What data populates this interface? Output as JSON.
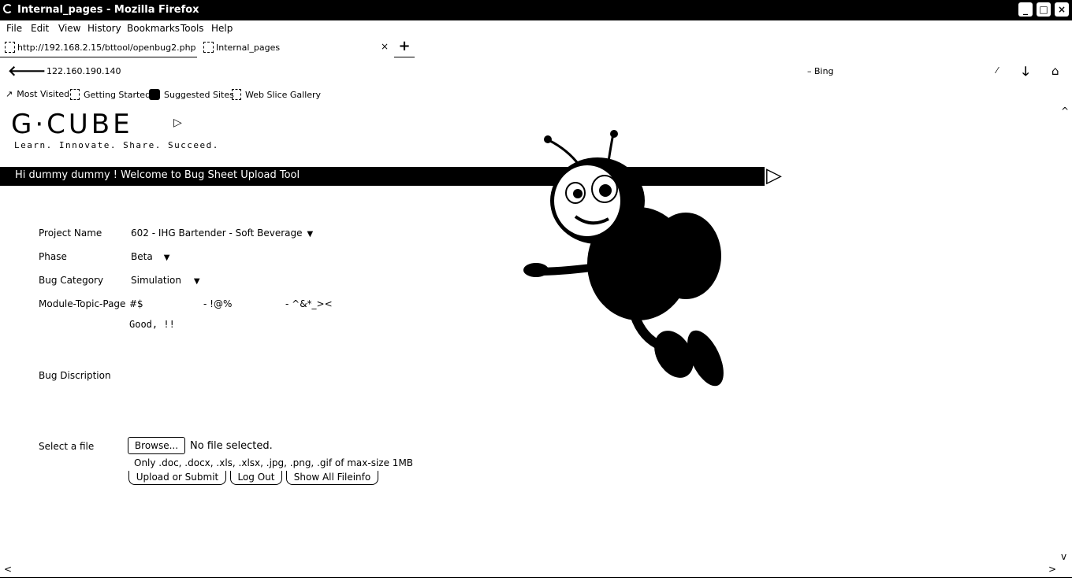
{
  "window": {
    "title": "Internal_pages - Mozilla Firefox"
  },
  "menu": [
    "File",
    "Edit",
    "View",
    "History",
    "Bookmarks",
    "Tools",
    "Help"
  ],
  "tabs": [
    {
      "label": "http://192.168.2.15/bttool/openbug2.php"
    },
    {
      "label": "Internal_pages",
      "close": "×"
    }
  ],
  "newtab": "+",
  "nav": {
    "url": "122.160.190.140",
    "search": "Bing"
  },
  "bookmarks": [
    "Most Visited",
    "Getting Started",
    "Suggested Sites",
    "Web Slice Gallery"
  ],
  "logo": {
    "name": "G·CUBE",
    "tagline": "Learn. Innovate. Share. Succeed."
  },
  "banner": "Hi dummy dummy ! Welcome to Bug Sheet Upload Tool",
  "form": {
    "project_label": "Project Name",
    "project_value": "602 - IHG Bartender - Soft Beverage",
    "phase_label": "Phase",
    "phase_value": "Beta",
    "category_label": "Bug Category",
    "category_value": "Simulation",
    "module_label": "Module-Topic-Page",
    "module_part1": "#$",
    "module_part2": "- !@%",
    "module_part3": "- ^&*_><",
    "description_text": "Good, !!",
    "description_label": "Bug Discription",
    "file_label": "Select a file",
    "browse_label": "Browse...",
    "no_file": "No file selected.",
    "file_hint": "Only .doc, .docx, .xls, .xlsx, .jpg, .png, .gif of max-size 1MB",
    "upload_button": "Upload or Submit",
    "logout_button": "Log Out",
    "show_all_button": "Show All Fileinfo"
  }
}
